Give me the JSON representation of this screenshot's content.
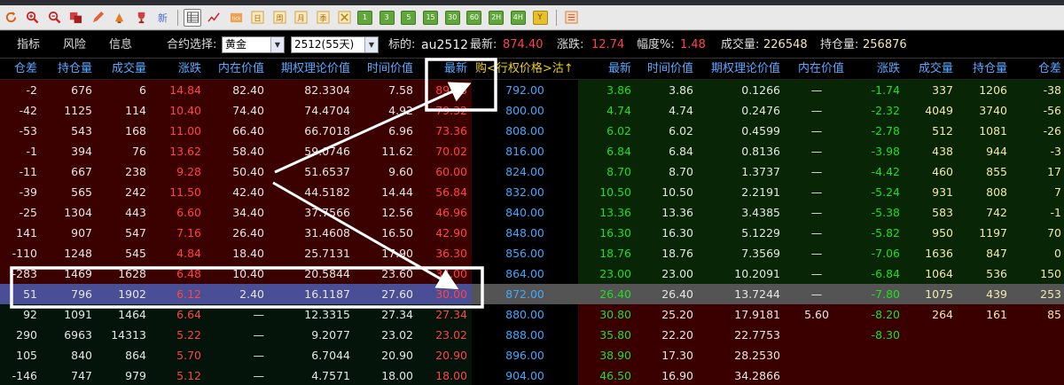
{
  "toolbar": {
    "icons": [
      "refresh-icon",
      "zoom-in-icon",
      "zoom-out-icon",
      "copy-icon",
      "draw-pen-icon",
      "paint-icon",
      "trophy-icon",
      "new-icon",
      "table-icon",
      "line-chart-icon",
      "tick-chart-icon",
      "daily-chart-icon",
      "weekly-chart-icon",
      "monthly-chart-icon",
      "quarterly-chart-icon",
      "cross-icon",
      "period-1-icon",
      "period-3-icon",
      "period-5-icon",
      "period-15-icon",
      "period-30-icon",
      "period-60-icon",
      "period-2h-icon",
      "period-4h-icon",
      "period-year-icon",
      "extra-icon"
    ],
    "new_label": "新",
    "tick_label": "tick",
    "day_label": "日",
    "week_label": "周",
    "month_label": "月",
    "quarter_label": "季",
    "periods": [
      "1",
      "3",
      "5",
      "15",
      "30",
      "60",
      "2H",
      "4H"
    ],
    "year_label": "Y"
  },
  "info": {
    "tabs": [
      "指标",
      "风险",
      "信息"
    ],
    "contract_label": "合约选择:",
    "contract_value": "黄金",
    "expiry_value": "2512(55天)",
    "underlying_label": "标的:",
    "underlying_value": "au2512",
    "last_label": "最新:",
    "last_value": "874.40",
    "change_label": "涨跌:",
    "change_value": "12.74",
    "pct_label": "幅度%:",
    "pct_value": "1.48",
    "volume_label": "成交量:",
    "volume_value": "226548",
    "oi_label": "持仓量:",
    "oi_value": "256876"
  },
  "headers": {
    "call": [
      "仓差",
      "持仓量",
      "成交量",
      "涨跌",
      "内在价值",
      "期权理论价值",
      "时间价值",
      "最新"
    ],
    "strike": "购<行权价格>沽↑",
    "put": [
      "最新",
      "时间价值",
      "期权理论价值",
      "内在价值",
      "涨跌",
      "成交量",
      "持仓量",
      "仓差"
    ]
  },
  "colors": {
    "call_itm": "#3b0000",
    "call_otm": "#04140a",
    "put_itm": "#082505",
    "put_otm": "#3a0000",
    "atm_call": "#4a4e96",
    "atm_put": "#545454",
    "up": "#ff4444",
    "down": "#22dd22",
    "header": "#5aa8ff",
    "strike": "#3fa9ff"
  },
  "rows": [
    {
      "call": [
        "-2",
        "676",
        "6",
        "14.84",
        "82.40",
        "82.3304",
        "7.58",
        "89.98"
      ],
      "strike": "792.00",
      "put": [
        "3.86",
        "3.86",
        "0.1266",
        "—",
        "-1.74",
        "337",
        "1206",
        "-38"
      ]
    },
    {
      "call": [
        "-42",
        "1125",
        "114",
        "10.40",
        "74.40",
        "74.4704",
        "4.92",
        "79.32"
      ],
      "strike": "800.00",
      "put": [
        "4.74",
        "4.74",
        "0.2476",
        "—",
        "-2.32",
        "4049",
        "3740",
        "-56"
      ]
    },
    {
      "call": [
        "-53",
        "543",
        "168",
        "11.00",
        "66.40",
        "66.7018",
        "6.96",
        "73.36"
      ],
      "strike": "808.00",
      "put": [
        "6.02",
        "6.02",
        "0.4599",
        "—",
        "-2.78",
        "512",
        "1081",
        "-26"
      ]
    },
    {
      "call": [
        "-1",
        "394",
        "76",
        "13.62",
        "58.40",
        "59.0746",
        "11.62",
        "70.02"
      ],
      "strike": "816.00",
      "put": [
        "6.84",
        "6.84",
        "0.8136",
        "—",
        "-3.98",
        "438",
        "944",
        "-3"
      ]
    },
    {
      "call": [
        "-11",
        "667",
        "238",
        "9.28",
        "50.40",
        "51.6537",
        "9.60",
        "60.00"
      ],
      "strike": "824.00",
      "put": [
        "8.70",
        "8.70",
        "1.3737",
        "—",
        "-4.42",
        "460",
        "855",
        "17"
      ]
    },
    {
      "call": [
        "-39",
        "565",
        "242",
        "11.50",
        "42.40",
        "44.5182",
        "14.44",
        "56.84"
      ],
      "strike": "832.00",
      "put": [
        "10.50",
        "10.50",
        "2.2191",
        "—",
        "-5.24",
        "931",
        "808",
        "7"
      ]
    },
    {
      "call": [
        "-25",
        "1304",
        "443",
        "6.60",
        "34.40",
        "37.7566",
        "12.56",
        "46.96"
      ],
      "strike": "840.00",
      "put": [
        "13.36",
        "13.36",
        "3.4385",
        "—",
        "-5.38",
        "583",
        "742",
        "-1"
      ]
    },
    {
      "call": [
        "141",
        "907",
        "547",
        "7.16",
        "26.40",
        "31.4608",
        "16.50",
        "42.90"
      ],
      "strike": "848.00",
      "put": [
        "16.30",
        "16.30",
        "5.1229",
        "—",
        "-5.82",
        "950",
        "1197",
        "70"
      ]
    },
    {
      "call": [
        "-110",
        "1248",
        "545",
        "4.84",
        "18.40",
        "25.7131",
        "17.90",
        "36.30"
      ],
      "strike": "856.00",
      "put": [
        "18.76",
        "18.76",
        "7.3569",
        "—",
        "-7.06",
        "1636",
        "847",
        "0"
      ]
    },
    {
      "call": [
        "-283",
        "1469",
        "1628",
        "6.48",
        "10.40",
        "20.5844",
        "23.60",
        "34.00"
      ],
      "strike": "864.00",
      "put": [
        "23.00",
        "23.00",
        "10.2091",
        "—",
        "-6.84",
        "1064",
        "536",
        "150"
      ]
    },
    {
      "call": [
        "51",
        "796",
        "1902",
        "6.12",
        "2.40",
        "16.1187",
        "27.60",
        "30.00"
      ],
      "strike": "872.00",
      "put": [
        "26.40",
        "26.40",
        "13.7244",
        "—",
        "-7.80",
        "1075",
        "439",
        "253"
      ]
    },
    {
      "call": [
        "92",
        "1091",
        "1464",
        "6.64",
        "—",
        "12.3315",
        "27.34",
        "27.34"
      ],
      "strike": "880.00",
      "put": [
        "30.80",
        "25.20",
        "17.9181",
        "5.60",
        "-8.20",
        "264",
        "161",
        "85"
      ]
    },
    {
      "call": [
        "290",
        "6963",
        "14313",
        "5.22",
        "—",
        "9.2077",
        "23.02",
        "23.02"
      ],
      "strike": "888.00",
      "put": [
        "35.80",
        "22.20",
        "22.7753",
        "",
        "-8.30",
        "",
        "",
        ""
      ]
    },
    {
      "call": [
        "105",
        "840",
        "864",
        "5.70",
        "—",
        "6.7044",
        "20.90",
        "20.90"
      ],
      "strike": "896.00",
      "put": [
        "38.90",
        "17.30",
        "28.2530",
        "",
        "",
        "",
        "",
        ""
      ]
    },
    {
      "call": [
        "-146",
        "747",
        "979",
        "5.12",
        "—",
        "4.7571",
        "18.00",
        "18.00"
      ],
      "strike": "904.00",
      "put": [
        "46.50",
        "16.90",
        "34.2866",
        "",
        "",
        "",
        "",
        ""
      ]
    }
  ]
}
